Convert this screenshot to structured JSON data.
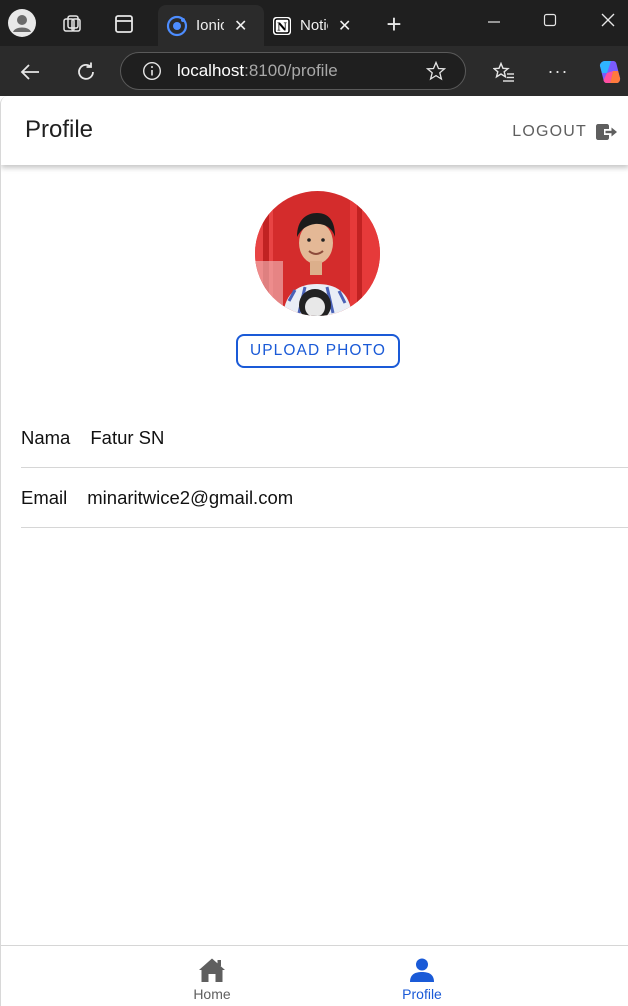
{
  "browser": {
    "tabs": [
      {
        "title": "Ionic App",
        "active": true
      },
      {
        "title": "Notion",
        "active": false
      }
    ],
    "url_host": "localhost",
    "url_path": ":8100/profile"
  },
  "header": {
    "title": "Profile",
    "logout_label": "LOGOUT"
  },
  "profile": {
    "upload_label": "UPLOAD PHOTO",
    "fields": [
      {
        "label": "Nama",
        "value": "Fatur SN"
      },
      {
        "label": "Email",
        "value": "minaritwice2@gmail.com"
      }
    ]
  },
  "bottom_tabs": [
    {
      "label": "Home",
      "icon": "home-icon",
      "selected": false
    },
    {
      "label": "Profile",
      "icon": "person-icon",
      "selected": true
    }
  ],
  "colors": {
    "primary": "#1a5ad7",
    "tab_inactive": "#5f5f5f",
    "avatar_bg": "#d42c2c"
  }
}
